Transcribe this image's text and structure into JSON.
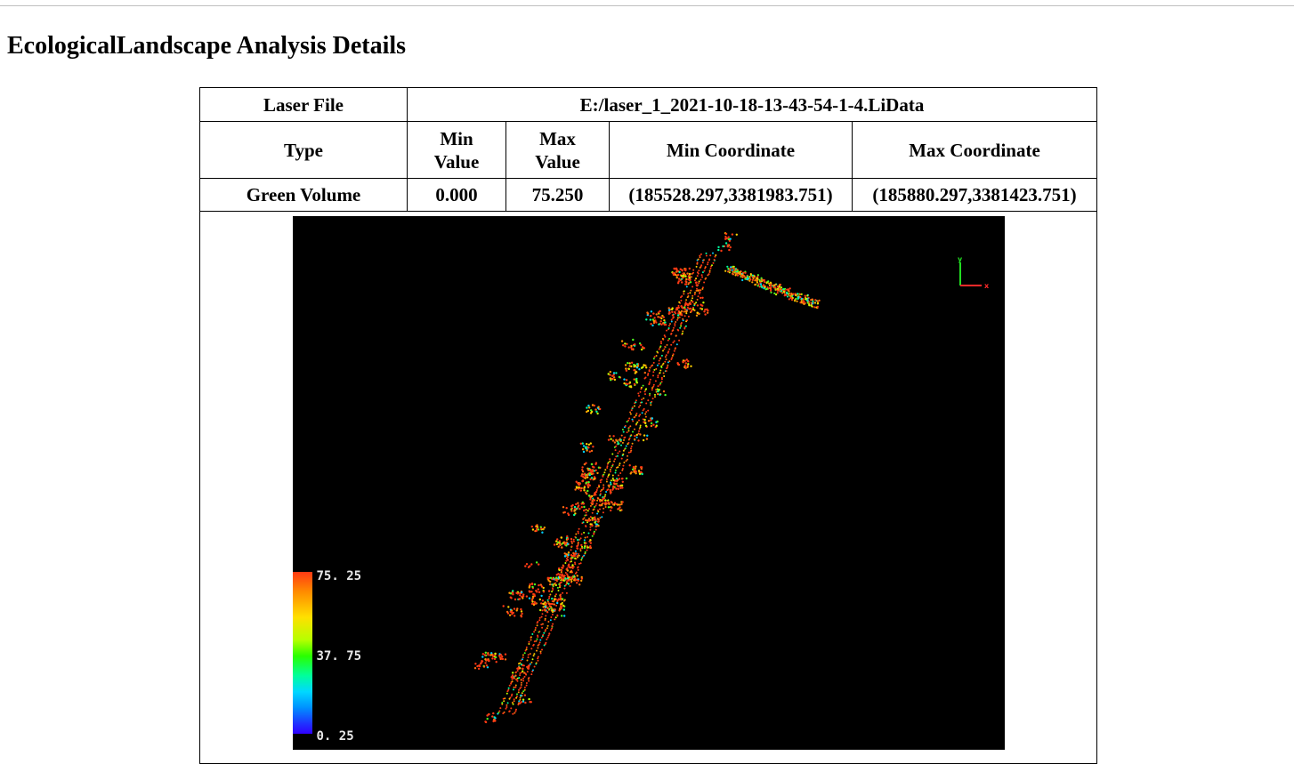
{
  "page": {
    "title": "EcologicalLandscape Analysis Details"
  },
  "details": {
    "laser_file_label": "Laser File",
    "laser_file_value": "E:/laser_1_2021-10-18-13-43-54-1-4.LiData",
    "headers": {
      "type": "Type",
      "min_value": "Min Value",
      "max_value": "Max Value",
      "min_coordinate": "Min Coordinate",
      "max_coordinate": "Max Coordinate"
    },
    "row": {
      "type": "Green Volume",
      "min_value": "0.000",
      "max_value": "75.250",
      "min_coordinate": "(185528.297,3381983.751)",
      "max_coordinate": "(185880.297,3381423.751)"
    }
  },
  "map": {
    "background": "#000000",
    "colorbar": {
      "max_label": "75. 25",
      "mid_label": "37. 75",
      "min_label": "0. 25"
    },
    "axis_labels": {
      "x": "x",
      "y": "y"
    },
    "axis_colors": {
      "x": "#ff2a2a",
      "y": "#22dd22"
    },
    "palette": [
      "#ff3a14",
      "#ff6a10",
      "#ff9a00",
      "#ffd000",
      "#c8ff00",
      "#50ff20",
      "#00ffa0",
      "#00d0ff"
    ]
  }
}
